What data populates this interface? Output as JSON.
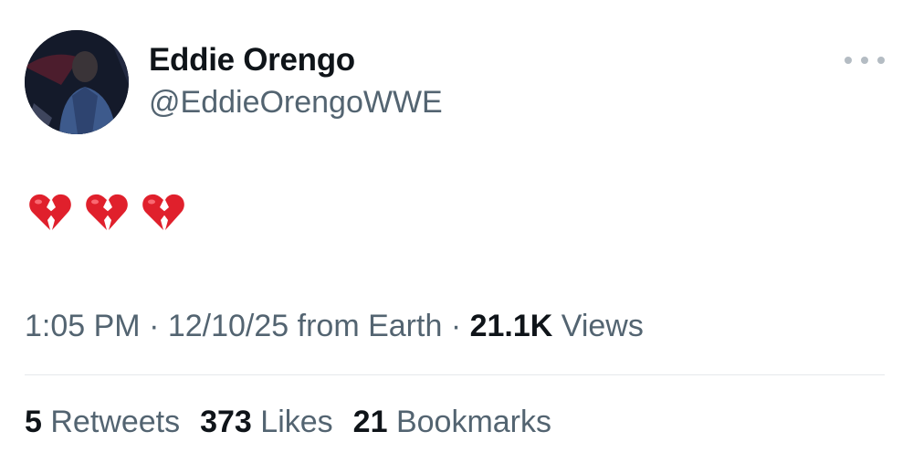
{
  "user": {
    "display_name": "Eddie Orengo",
    "handle": "@EddieOrengoWWE"
  },
  "tweet": {
    "content_emojis": [
      "broken-heart",
      "broken-heart",
      "broken-heart"
    ],
    "emoji_color": "#e0202c"
  },
  "meta": {
    "time": "1:05 PM",
    "sep1": " · ",
    "date": "12/10/25",
    "source": " from Earth",
    "sep2": " · ",
    "views_count": "21.1K",
    "views_label": " Views"
  },
  "stats": {
    "retweets_count": "5",
    "retweets_label": " Retweets",
    "likes_count": "373",
    "likes_label": " Likes",
    "bookmarks_count": "21",
    "bookmarks_label": " Bookmarks"
  },
  "icons": {
    "more": "more-horizontal-icon"
  }
}
